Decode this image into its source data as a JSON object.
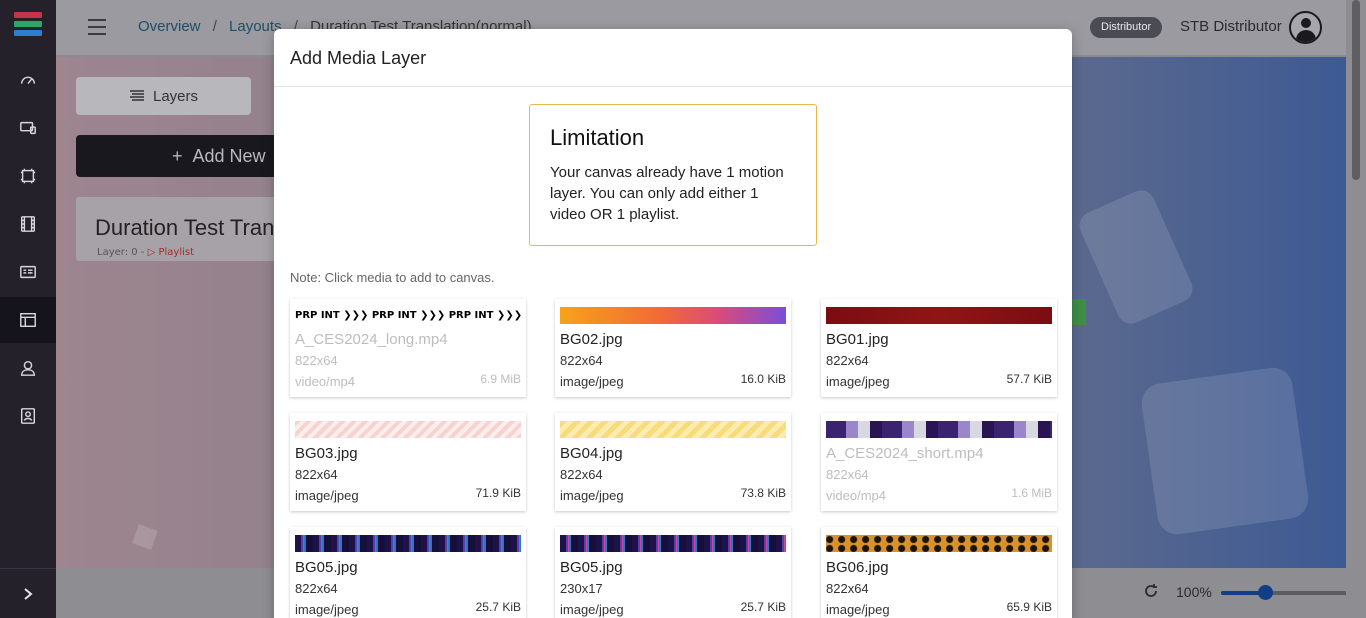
{
  "header": {
    "breadcrumbs": [
      "Overview",
      "Layouts",
      "Duration Test Translation(normal)"
    ],
    "role_badge": "Distributor",
    "user_name": "STB Distributor"
  },
  "sidebar": {
    "logo_colors": [
      "#c5334a",
      "#2ea36a",
      "#2c7ecf"
    ],
    "items": [
      {
        "icon": "dashboard-icon"
      },
      {
        "icon": "monitor-icon"
      },
      {
        "icon": "screen-frame-icon"
      },
      {
        "icon": "film-icon"
      },
      {
        "icon": "media-icon"
      },
      {
        "icon": "layout-icon",
        "active": true
      },
      {
        "icon": "users-icon"
      },
      {
        "icon": "contacts-icon"
      }
    ]
  },
  "left_panel": {
    "layers_label": "Layers",
    "add_new_label": "Add New",
    "layer_title": "Duration Test Translation(normal)",
    "layer_meta": "Layer: 0 -",
    "layer_type": "Playlist"
  },
  "bottom_bar": {
    "zoom": "100%",
    "zoom_fraction": 0.3
  },
  "modal": {
    "title": "Add Media Layer",
    "limitation_title": "Limitation",
    "limitation_text": "Your canvas already have 1 motion layer. You can only add either 1 video OR 1 playlist.",
    "note": "Note: Click media to add to canvas.",
    "media": [
      {
        "name": "A_CES2024_long.mp4",
        "dims": "822x64",
        "mime": "video/mp4",
        "size": "6.9 MiB",
        "disabled": true,
        "thumb_text": "PRP INT ❯❯❯ PRP INT ❯❯❯ PRP INT ❯❯❯"
      },
      {
        "name": "BG02.jpg",
        "dims": "822x64",
        "mime": "image/jpeg",
        "size": "16.0 KiB",
        "disabled": false
      },
      {
        "name": "BG01.jpg",
        "dims": "822x64",
        "mime": "image/jpeg",
        "size": "57.7 KiB",
        "disabled": false
      },
      {
        "name": "BG03.jpg",
        "dims": "822x64",
        "mime": "image/jpeg",
        "size": "71.9 KiB",
        "disabled": false
      },
      {
        "name": "BG04.jpg",
        "dims": "822x64",
        "mime": "image/jpeg",
        "size": "73.8 KiB",
        "disabled": false
      },
      {
        "name": "A_CES2024_short.mp4",
        "dims": "822x64",
        "mime": "video/mp4",
        "size": "1.6 MiB",
        "disabled": true
      },
      {
        "name": "BG05.jpg",
        "dims": "822x64",
        "mime": "image/jpeg",
        "size": "25.7 KiB",
        "disabled": false
      },
      {
        "name": "BG05.jpg",
        "dims": "230x17",
        "mime": "image/jpeg",
        "size": "25.7 KiB",
        "disabled": false
      },
      {
        "name": "BG06.jpg",
        "dims": "822x64",
        "mime": "image/jpeg",
        "size": "65.9 KiB",
        "disabled": false
      }
    ]
  }
}
